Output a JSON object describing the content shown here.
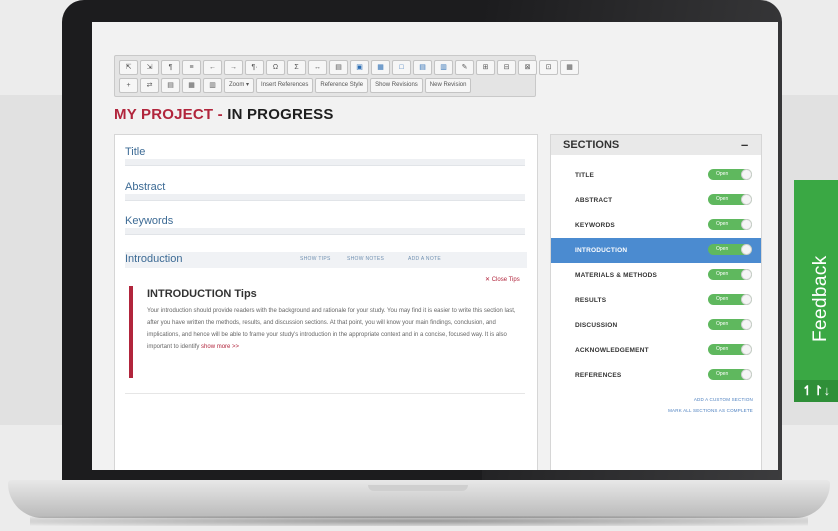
{
  "toolbar": {
    "row1": [
      "⇱",
      "⇲",
      "¶",
      "≡",
      "←",
      "→",
      "¶·",
      "Ω",
      "Σ",
      "↔",
      "▤",
      "▣",
      "▦",
      "□",
      "▤",
      "▥",
      "✎",
      "⊞",
      "⊟",
      "⊠",
      "⊡",
      "▦"
    ],
    "row2_icons": [
      "+",
      "⇄",
      "▤",
      "▦",
      "▥"
    ],
    "zoom": "Zoom",
    "zoom_arrow": "▾",
    "insert_references": "Insert References",
    "reference_style": "Reference Style",
    "show_revisions": "Show Revisions",
    "new_revision": "New Revision"
  },
  "project": {
    "name": "MY PROJECT",
    "separator": "-",
    "status": "IN PROGRESS"
  },
  "editor": {
    "fields": [
      "Title",
      "Abstract",
      "Keywords"
    ],
    "introduction": {
      "label": "Introduction",
      "show_tips": "SHOW TIPS",
      "show_notes": "SHOW NOTES",
      "add_note": "ADD A NOTE"
    },
    "close_tips": "✕ Close Tips",
    "tips_heading": "INTRODUCTION Tips",
    "tips_text": "Your introduction should provide readers with the background and rationale for your study. You may find it is easier to write this section last, after you have written the methods, results, and discussion sections. At that point, you will know your main findings, conclusion, and implications, and hence will be able to frame your study's introduction in the appropriate context and in a concise, focused way. It is also important to identify",
    "show_more": "show more >>"
  },
  "sections": {
    "title": "SECTIONS",
    "collapse": "–",
    "items": [
      {
        "label": "TITLE",
        "toggle": "Open"
      },
      {
        "label": "ABSTRACT",
        "toggle": "Open"
      },
      {
        "label": "KEYWORDS",
        "toggle": "Open"
      },
      {
        "label": "INTRODUCTION",
        "toggle": "Open"
      },
      {
        "label": "MATERIALS & METHODS",
        "toggle": "Open"
      },
      {
        "label": "RESULTS",
        "toggle": "Open"
      },
      {
        "label": "DISCUSSION",
        "toggle": "Open"
      },
      {
        "label": "ACKNOWLEDGEMENT",
        "toggle": "Open"
      },
      {
        "label": "REFERENCES",
        "toggle": "Open"
      }
    ],
    "active": "INTRODUCTION",
    "add_custom": "ADD A CUSTOM SECTION",
    "mark_all": "MARK ALL SECTIONS AS COMPLETE"
  },
  "feedback": {
    "label": "Feedback",
    "icon": "↿↾↓"
  },
  "colors": {
    "brand_red": "#b1253c",
    "accent_blue": "#4b8bd0",
    "toggle_green": "#5fb85e",
    "feedback_green": "#3aa844"
  }
}
